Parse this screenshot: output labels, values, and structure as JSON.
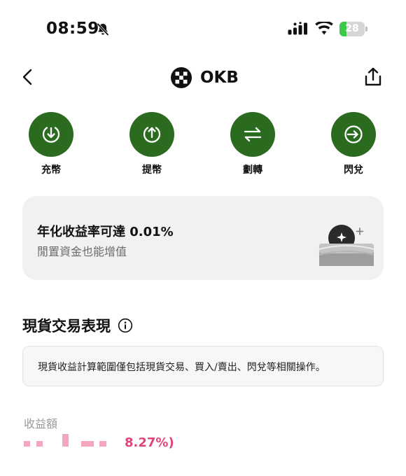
{
  "status_bar": {
    "time": "08:59",
    "battery_level": "28",
    "battery_fraction": 0.28,
    "colors": {
      "battery_fill": "#3cc84a"
    }
  },
  "header": {
    "title": "OKB",
    "icons": [
      "chevron-left-icon",
      "okb-logo",
      "share-icon"
    ]
  },
  "actions": [
    {
      "label": "充幣",
      "icon": "deposit-icon"
    },
    {
      "label": "提幣",
      "icon": "withdraw-icon"
    },
    {
      "label": "劃轉",
      "icon": "transfer-icon"
    },
    {
      "label": "閃兌",
      "icon": "convert-icon"
    }
  ],
  "yield_card": {
    "title": "年化收益率可達 0.01%",
    "subtitle": "閒置資金也能增值"
  },
  "spot_section": {
    "title": "現貨交易表現",
    "note": "現貨收益計算範圍僅包括現貨交易、買入/賣出、閃兌等相關操作。",
    "pnl_label": "收益額",
    "pnl_percent": "8.27%)"
  },
  "colors": {
    "accent_green": "#2a6b1f",
    "pnl_pink": "#e0457a"
  }
}
